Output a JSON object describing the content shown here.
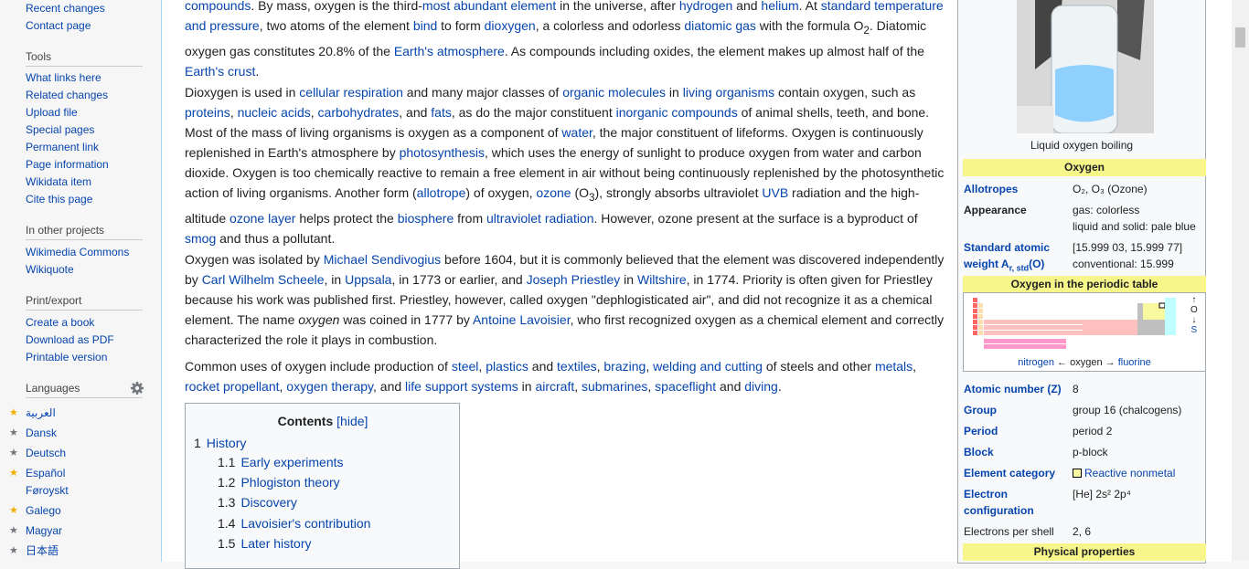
{
  "sidebar": {
    "top_links": [
      "Recent changes",
      "Contact page"
    ],
    "tools_heading": "Tools",
    "tools": [
      "What links here",
      "Related changes",
      "Upload file",
      "Special pages",
      "Permanent link",
      "Page information",
      "Wikidata item",
      "Cite this page"
    ],
    "projects_heading": "In other projects",
    "projects": [
      "Wikimedia Commons",
      "Wikiquote"
    ],
    "print_heading": "Print/export",
    "print": [
      "Create a book",
      "Download as PDF",
      "Printable version"
    ],
    "languages_heading": "Languages",
    "languages": [
      {
        "label": "العربية",
        "star": "gold"
      },
      {
        "label": "Dansk",
        "star": "gray"
      },
      {
        "label": "Deutsch",
        "star": "gray"
      },
      {
        "label": "Español",
        "star": "gold"
      },
      {
        "label": "Føroyskt",
        "star": ""
      },
      {
        "label": "Galego",
        "star": "gold"
      },
      {
        "label": "Magyar",
        "star": "gray"
      },
      {
        "label": "日本語",
        "star": "gray"
      }
    ]
  },
  "article": {
    "p1_line1_a": "compounds",
    "p1_line1_b": ". By mass, oxygen is the third-",
    "p1_line1_c": "most abundant element",
    "p1_line1_d": " in the universe, after ",
    "p1_line1_e": "hydrogen",
    "p1_line1_f": " and ",
    "p1_line1_g": "helium",
    "p1_line1_h": ". At ",
    "p1_line1_i": "standard temperature",
    "p1_line2_a": "and pressure",
    "p1_line2_b": ", two atoms of the element ",
    "p1_line2_c": "bind",
    "p1_line2_d": " to form ",
    "p1_line2_e": "dioxygen",
    "p1_line2_f": ", a colorless and odorless ",
    "p1_line2_g": "diatomic gas",
    "p1_line2_h": " with the formula O",
    "p1_line2_sub": "2",
    "p1_line2_i": ". Diatomic",
    "p1_line3_a": "oxygen gas constitutes 20.8% of the ",
    "p1_line3_b": "Earth's atmosphere",
    "p1_line3_c": ". As compounds including oxides, the element makes up almost half of the",
    "p1_line4_a": "Earth's crust",
    "p1_line4_b": ".",
    "p2_l1": [
      "Dioxygen is used in ",
      "cellular respiration",
      " and many major classes of ",
      "organic molecules",
      " in ",
      "living organisms",
      " contain oxygen, such as"
    ],
    "p2_l2": [
      "proteins",
      ", ",
      "nucleic acids",
      ", ",
      "carbohydrates",
      ", and ",
      "fats",
      ", as do the major constituent ",
      "inorganic compounds",
      " of animal shells, teeth, and bone."
    ],
    "p2_l3": [
      "Most of the mass of living organisms is oxygen as a component of ",
      "water",
      ", the major constituent of lifeforms. Oxygen is continuously"
    ],
    "p2_l4": [
      "replenished in Earth's atmosphere by ",
      "photosynthesis",
      ", which uses the energy of sunlight to produce oxygen from water and carbon"
    ],
    "p2_l5": [
      "dioxide. Oxygen is too chemically reactive to remain a free element in air without being continuously replenished by the photosynthetic"
    ],
    "p2_l6": [
      "action of living organisms. Another form (",
      "allotrope",
      ") of oxygen, ",
      "ozone",
      " (O",
      "3",
      "), strongly absorbs ultraviolet ",
      "UVB",
      " radiation and the high-"
    ],
    "p2_l7": [
      "altitude ",
      "ozone layer",
      " helps protect the ",
      "biosphere",
      " from ",
      "ultraviolet radiation",
      ". However, ozone present at the surface is a byproduct of"
    ],
    "p2_l8": [
      "smog",
      " and thus a pollutant."
    ],
    "p3_l1": [
      "Oxygen was isolated by ",
      "Michael Sendivogius",
      " before 1604, but it is commonly believed that the element was discovered independently"
    ],
    "p3_l2": [
      "by ",
      "Carl Wilhelm Scheele",
      ", in ",
      "Uppsala",
      ", in 1773 or earlier, and ",
      "Joseph Priestley",
      " in ",
      "Wiltshire",
      ", in 1774. Priority is often given for Priestley"
    ],
    "p3_l3": [
      "because his work was published first. Priestley, however, called oxygen \"dephlogisticated air\", and did not recognize it as a chemical"
    ],
    "p3_l4": [
      "element. The name ",
      "oxygen",
      " was coined in 1777 by ",
      "Antoine Lavoisier",
      ", who first recognized oxygen as a chemical element and correctly"
    ],
    "p3_l5": [
      "characterized the role it plays in combustion."
    ],
    "p4_l1": [
      "Common uses of oxygen include production of ",
      "steel",
      ", ",
      "plastics",
      " and ",
      "textiles",
      ", ",
      "brazing",
      ", ",
      "welding and cutting",
      " of steels and other ",
      "metals",
      ","
    ],
    "p4_l2": [
      "rocket propellant",
      ", ",
      "oxygen therapy",
      ", and ",
      "life support systems",
      " in ",
      "aircraft",
      ", ",
      "submarines",
      ", ",
      "spaceflight",
      " and ",
      "diving",
      "."
    ]
  },
  "toc": {
    "title": "Contents",
    "hide_label": "[hide]",
    "items": [
      {
        "num": "1",
        "label": "History"
      },
      {
        "num": "1.1",
        "label": "Early experiments"
      },
      {
        "num": "1.2",
        "label": "Phlogiston theory"
      },
      {
        "num": "1.3",
        "label": "Discovery"
      },
      {
        "num": "1.4",
        "label": "Lavoisier's contribution"
      },
      {
        "num": "1.5",
        "label": "Later history"
      }
    ]
  },
  "infobox": {
    "caption": "Liquid oxygen boiling",
    "title": "Oxygen",
    "allotropes_label": "Allotropes",
    "allotropes_value": "O₂, O₃ (Ozone)",
    "appearance_label": "Appearance",
    "appearance_v1": "gas: colorless",
    "appearance_v2": "liquid and solid: pale blue",
    "saw_label1": "Standard atomic",
    "saw_label2": "weight A",
    "saw_label_sub": "r, std",
    "saw_label_suffix": "(O)",
    "saw_v1": "[15.999 03, 15.999 77]",
    "saw_v2": "conventional: 15.999",
    "pt_header": "Oxygen in the periodic table",
    "pt_nav_left": "nitrogen",
    "pt_nav_mid": " ← oxygen → ",
    "pt_nav_right": "fluorine",
    "pt_up": "↑",
    "pt_o": "O",
    "pt_down": "↓",
    "pt_s": "S",
    "z_label": "Atomic number (Z)",
    "z_value": "8",
    "group_label": "Group",
    "group_value": "group 16 (chalcogens)",
    "period_label": "Period",
    "period_value": "period 2",
    "block_label": "Block",
    "block_value": "p-block",
    "category_label": "Element category",
    "category_value": "Reactive nonmetal",
    "config_label1": "Electron",
    "config_label2": "configuration",
    "config_value": "[He] 2s² 2p⁴",
    "shell_label": "Electrons per shell",
    "shell_value": "2, 6",
    "physical_header": "Physical properties",
    "colors": {
      "header": "#f6f68a",
      "pt_yellow": "#f8f8a0",
      "pt_pink": "#ff99cc",
      "pt_gray": "#c0c0c0"
    }
  }
}
